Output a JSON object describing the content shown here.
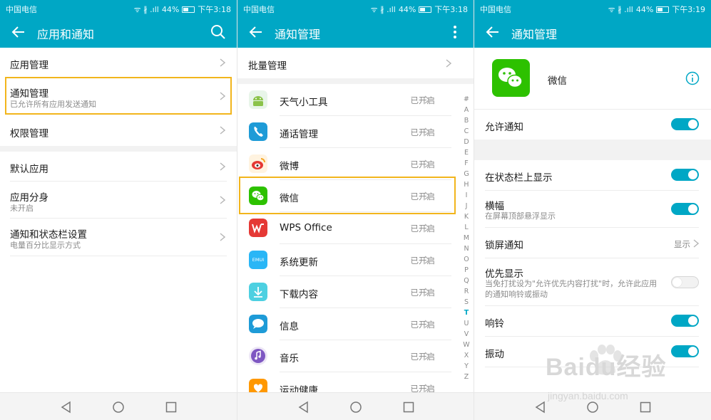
{
  "status": {
    "carrier": "中国电信",
    "battery": "44%",
    "times": [
      "下午3:18",
      "下午3:18",
      "下午3:19"
    ]
  },
  "screen1": {
    "title": "应用和通知",
    "items": [
      {
        "label": "应用管理",
        "sub": ""
      },
      {
        "label": "通知管理",
        "sub": "已允许所有应用发送通知"
      },
      {
        "label": "权限管理",
        "sub": ""
      },
      {
        "label": "默认应用",
        "sub": ""
      },
      {
        "label": "应用分身",
        "sub": "未开启"
      },
      {
        "label": "通知和状态栏设置",
        "sub": "电量百分比显示方式"
      }
    ]
  },
  "screen2": {
    "title": "通知管理",
    "batch": "批量管理",
    "apps": [
      {
        "name": "天气小工具",
        "status": "已开启",
        "icon": "android-icon",
        "color": "#8bc34a"
      },
      {
        "name": "通话管理",
        "status": "已开启",
        "icon": "phone-icon",
        "color": "#1e9bd7"
      },
      {
        "name": "微博",
        "status": "已开启",
        "icon": "weibo-icon",
        "color": "#f5a623"
      },
      {
        "name": "微信",
        "status": "已开启",
        "icon": "wechat-icon",
        "color": "#2dc100"
      },
      {
        "name": "WPS Office",
        "status": "已开启",
        "icon": "wps-icon",
        "color": "#e53935"
      },
      {
        "name": "系统更新",
        "status": "已开启",
        "icon": "emui-icon",
        "color": "#29b6f6"
      },
      {
        "name": "下载内容",
        "status": "已开启",
        "icon": "download-icon",
        "color": "#4dd0e1"
      },
      {
        "name": "信息",
        "status": "已开启",
        "icon": "message-icon",
        "color": "#1e9bd7"
      },
      {
        "name": "音乐",
        "status": "已开启",
        "icon": "music-icon",
        "color": "#7e57c2"
      },
      {
        "name": "运动健康",
        "status": "已开启",
        "icon": "health-icon",
        "color": "#ff9800"
      }
    ],
    "emui_text": "EMUI",
    "alphabet": [
      "#",
      "A",
      "B",
      "C",
      "D",
      "E",
      "F",
      "G",
      "H",
      "I",
      "J",
      "K",
      "L",
      "M",
      "N",
      "O",
      "P",
      "Q",
      "R",
      "S",
      "T",
      "U",
      "V",
      "W",
      "X",
      "Y",
      "Z"
    ]
  },
  "screen3": {
    "title": "通知管理",
    "app_name": "微信",
    "rows": [
      {
        "label": "允许通知",
        "sub": "",
        "state": "on"
      },
      {
        "label": "在状态栏上显示",
        "sub": "",
        "state": "on"
      },
      {
        "label": "横幅",
        "sub": "在屏幕顶部悬浮显示",
        "state": "on"
      },
      {
        "label": "锁屏通知",
        "sub": "",
        "value": "显示"
      },
      {
        "label": "优先显示",
        "sub": "当免打扰设为\"允许优先内容打扰\"时，允许此应用的通知响铃或振动",
        "state": "off"
      },
      {
        "label": "响铃",
        "sub": "",
        "state": "on"
      },
      {
        "label": "振动",
        "sub": "",
        "state": "on"
      }
    ]
  },
  "watermark": {
    "brand": "Baidu经验",
    "url": "jingyan.baidu.com"
  },
  "colors": {
    "accent": "#00a7c5",
    "highlight": "#f2b51c",
    "wechat": "#2dc100"
  }
}
